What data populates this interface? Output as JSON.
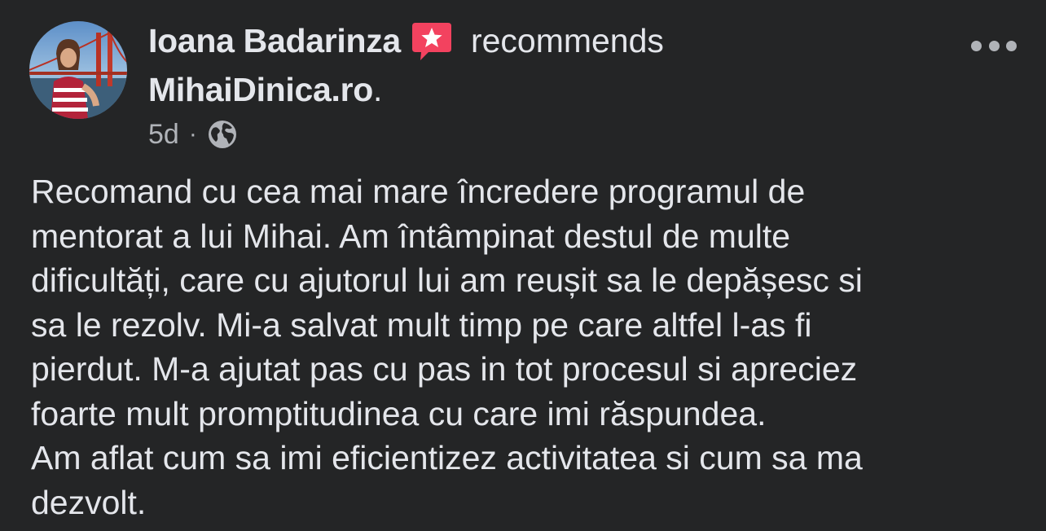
{
  "post": {
    "author_name": "Ioana Badarinza",
    "action_text": "recommends",
    "page_name": "MihaiDinica.ro",
    "page_suffix": ".",
    "timestamp": "5d",
    "separator": "·",
    "audience_icon": "globe-icon",
    "recommend_icon": "recommend-star-icon",
    "more_icon": "more-options-icon",
    "body_lines": [
      "Recomand cu cea mai mare încredere programul de",
      "mentorat a lui Mihai. Am întâmpinat destul de multe",
      "dificultăți, care cu ajutorul lui am reușit sa le depășesc si",
      "sa le rezolv. Mi-a salvat mult timp pe care altfel l-as fi",
      "pierdut. M-a ajutat pas cu pas in tot procesul si apreciez",
      "foarte mult promptitudinea cu care imi răspundea.",
      "Am aflat cum sa imi eficientizez activitatea si cum sa ma",
      "dezvolt."
    ]
  },
  "colors": {
    "background": "#242526",
    "primary_text": "#e4e6eb",
    "secondary_text": "#b0b3b8",
    "recommend_badge": "#f3425f"
  }
}
